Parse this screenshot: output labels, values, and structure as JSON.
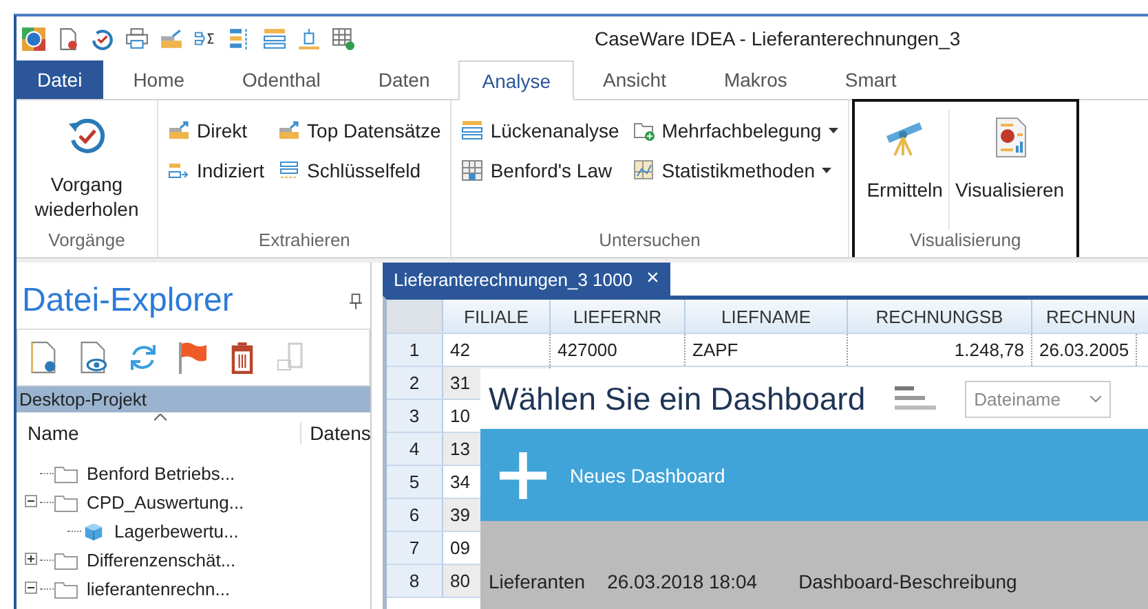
{
  "window": {
    "title": "CaseWare IDEA - Lieferanterechnungen_3"
  },
  "ribbon_tabs": [
    {
      "label": "Datei",
      "kind": "file",
      "selected": false
    },
    {
      "label": "Home",
      "kind": "tab",
      "selected": false
    },
    {
      "label": "Odenthal",
      "kind": "tab",
      "selected": false
    },
    {
      "label": "Daten",
      "kind": "tab",
      "selected": false
    },
    {
      "label": "Analyse",
      "kind": "tab",
      "selected": true
    },
    {
      "label": "Ansicht",
      "kind": "tab",
      "selected": false
    },
    {
      "label": "Makros",
      "kind": "tab",
      "selected": false
    },
    {
      "label": "Smart",
      "kind": "tab",
      "selected": false
    }
  ],
  "ribbon_groups": [
    {
      "title": "Vorgänge",
      "highlighted": false,
      "items": [
        {
          "label": "Vorgang wiederholen",
          "kind": "large"
        }
      ]
    },
    {
      "title": "Extrahieren",
      "highlighted": false,
      "items": [
        {
          "label": "Direkt",
          "kind": "small",
          "has_menu": false
        },
        {
          "label": "Top Datensätze",
          "kind": "small",
          "has_menu": false
        },
        {
          "label": "Indiziert",
          "kind": "small",
          "has_menu": false
        },
        {
          "label": "Schlüsselfeld",
          "kind": "small",
          "has_menu": false
        }
      ]
    },
    {
      "title": "Untersuchen",
      "highlighted": false,
      "items": [
        {
          "label": "Lückenanalyse",
          "kind": "small",
          "has_menu": false
        },
        {
          "label": "Mehrfachbelegung",
          "kind": "small",
          "has_menu": true
        },
        {
          "label": "Benford's Law",
          "kind": "small",
          "has_menu": false
        },
        {
          "label": "Statistikmethoden",
          "kind": "small",
          "has_menu": true
        }
      ]
    },
    {
      "title": "Visualisierung",
      "highlighted": true,
      "items": [
        {
          "label": "Ermitteln",
          "kind": "large"
        },
        {
          "label": "Visualisieren",
          "kind": "large"
        }
      ]
    }
  ],
  "explorer": {
    "title": "Datei-Explorer",
    "project": "Desktop-Projekt",
    "columns": [
      "Name",
      "Datens"
    ],
    "tree": [
      {
        "label": "Benford Betriebs...",
        "kind": "folder",
        "has_children": false
      },
      {
        "label": "CPD_Auswertung...",
        "kind": "folder",
        "has_children": true,
        "expanded": true,
        "children": [
          {
            "label": "Lagerbewertu...",
            "kind": "database",
            "has_children": false
          }
        ]
      },
      {
        "label": "Differenzenschät...",
        "kind": "folder",
        "has_children": true,
        "expanded": false
      },
      {
        "label": "lieferantenrechn...",
        "kind": "folder",
        "has_children": true,
        "expanded": true
      }
    ]
  },
  "document_tab": {
    "label": "Lieferanterechnungen_3 1000",
    "close": "×"
  },
  "table": {
    "columns": [
      "FILIALE",
      "LIEFERNR",
      "LIEFNAME",
      "RECHNUNGSB",
      "RECHNUN"
    ],
    "rows": [
      {
        "number": "1",
        "cells": [
          "42",
          "427000",
          "ZAPF",
          "1.248,78",
          "26.03.2005"
        ]
      },
      {
        "number": "2",
        "cells": [
          "31"
        ]
      },
      {
        "number": "3",
        "cells": [
          "10"
        ]
      },
      {
        "number": "4",
        "cells": [
          "13"
        ]
      },
      {
        "number": "5",
        "cells": [
          "34"
        ]
      },
      {
        "number": "6",
        "cells": [
          "39"
        ]
      },
      {
        "number": "7",
        "cells": [
          "09"
        ]
      },
      {
        "number": "8",
        "cells": [
          "80"
        ]
      }
    ]
  },
  "dashboard": {
    "title": "Wählen Sie ein Dashboard",
    "sort_value": "Dateiname",
    "new_label": "Neues Dashboard",
    "entries": [
      {
        "name": "Lieferanten",
        "date": "26.03.2018 18:04",
        "description": "Dashboard-Beschreibung"
      }
    ]
  }
}
